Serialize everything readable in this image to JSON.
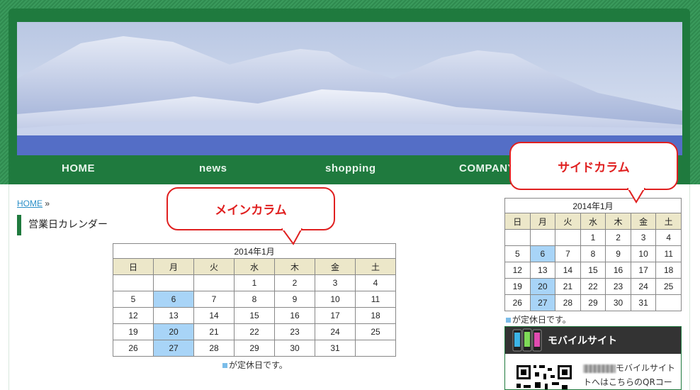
{
  "nav": {
    "items": [
      "HOME",
      "news",
      "shopping",
      "COMPANY"
    ]
  },
  "breadcrumb": {
    "home": "HOME",
    "separator": "»"
  },
  "page_title": "営業日カレンダー",
  "callouts": {
    "main": "メインカラム",
    "side": "サイドカラム"
  },
  "calendar": {
    "caption": "2014年1月",
    "weekdays": [
      "日",
      "月",
      "火",
      "水",
      "木",
      "金",
      "土"
    ],
    "weeks": [
      [
        "",
        "",
        "",
        "1",
        "2",
        "3",
        "4"
      ],
      [
        "5",
        "6",
        "7",
        "8",
        "9",
        "10",
        "11"
      ],
      [
        "12",
        "13",
        "14",
        "15",
        "16",
        "17",
        "18"
      ],
      [
        "19",
        "20",
        "21",
        "22",
        "23",
        "24",
        "25"
      ],
      [
        "26",
        "27",
        "28",
        "29",
        "30",
        "31",
        ""
      ]
    ],
    "holidays": [
      "6",
      "20",
      "27"
    ],
    "holiday_color": "#a8d4f7",
    "legend": "が定休日です。"
  },
  "mobile": {
    "title": "モバイルサイト",
    "text_line1": "モバイルサイト",
    "text_line2": "トへはこちらのQRコー"
  },
  "colors": {
    "brand_green": "#1f7a3e",
    "callout_red": "#e02020",
    "header_th": "#ece7c9"
  }
}
